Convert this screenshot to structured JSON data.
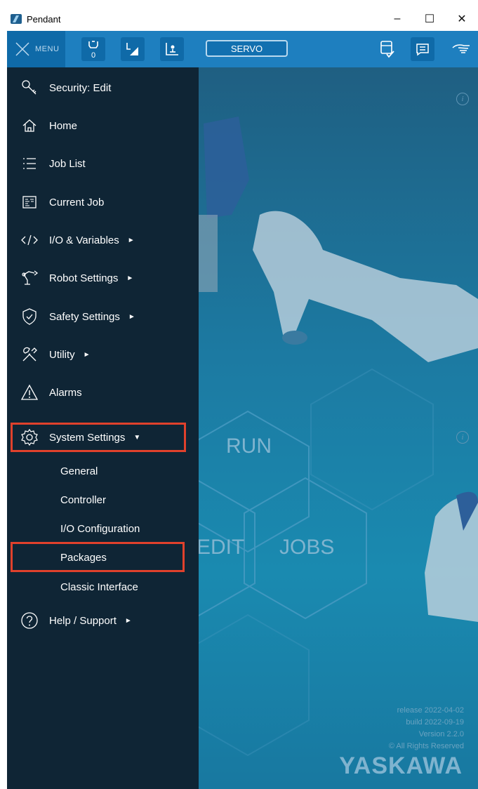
{
  "window": {
    "title": "Pendant",
    "minimize": "–",
    "maximize": "☐",
    "close": "✕"
  },
  "toolbar": {
    "menu_label": "MENU",
    "tool_count": "0",
    "servo_label": "SERVO"
  },
  "menu": {
    "items": [
      {
        "label": "Security: Edit",
        "icon": "key-icon"
      },
      {
        "label": "Home",
        "icon": "home-icon"
      },
      {
        "label": "Job List",
        "icon": "list-icon"
      },
      {
        "label": "Current Job",
        "icon": "job-icon"
      },
      {
        "label": "I/O & Variables",
        "icon": "code-icon",
        "arrow": "►"
      },
      {
        "label": "Robot Settings",
        "icon": "robot-icon",
        "arrow": "►"
      },
      {
        "label": "Safety Settings",
        "icon": "shield-icon",
        "arrow": "►"
      },
      {
        "label": "Utility",
        "icon": "tools-icon",
        "arrow": "►"
      },
      {
        "label": "Alarms",
        "icon": "warning-icon"
      },
      {
        "label": "System Settings",
        "icon": "gear-icon",
        "arrow": "▼"
      },
      {
        "label": "Help / Support",
        "icon": "help-icon",
        "arrow": "►"
      }
    ],
    "system_sub": [
      "General",
      "Controller",
      "I/O Configuration",
      "Packages",
      "Classic Interface"
    ],
    "highlight_color": "#e0412c"
  },
  "background": {
    "hex_labels": [
      "RUN",
      "EDIT",
      "JOBS"
    ],
    "release": "release 2022-04-02",
    "build": "build 2022-09-19",
    "version": "Version 2.2.0",
    "rights": "© All Rights Reserved",
    "logo": "YASKAWA",
    "info": "i"
  }
}
